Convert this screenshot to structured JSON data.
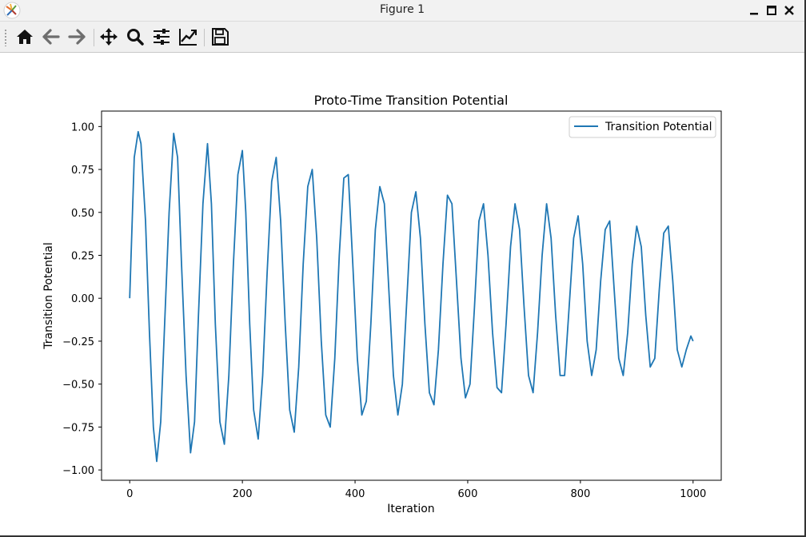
{
  "window": {
    "title": "Figure 1",
    "controls": [
      "minimize-icon",
      "maximize-icon",
      "close-icon"
    ]
  },
  "toolbar": {
    "buttons": [
      {
        "name": "home",
        "icon": "home-icon"
      },
      {
        "name": "back",
        "icon": "arrow-left-icon"
      },
      {
        "name": "forward",
        "icon": "arrow-right-icon"
      },
      {
        "name": "pan",
        "icon": "move-icon"
      },
      {
        "name": "zoom",
        "icon": "magnifier-icon"
      },
      {
        "name": "configure-subplots",
        "icon": "sliders-icon"
      },
      {
        "name": "edit-axis",
        "icon": "line-chart-icon"
      },
      {
        "name": "save",
        "icon": "floppy-disk-icon"
      }
    ]
  },
  "colors": {
    "line": "#1f77b4",
    "axes": "#000000",
    "background": "#ffffff"
  },
  "chart_data": {
    "type": "line",
    "title": "Proto-Time Transition Potential",
    "xlabel": "Iteration",
    "ylabel": "Transition Potential",
    "xlim": [
      -50,
      1050
    ],
    "ylim": [
      -1.06,
      1.09
    ],
    "xticks": [
      0,
      200,
      400,
      600,
      800,
      1000
    ],
    "xtick_labels": [
      "0",
      "200",
      "400",
      "600",
      "800",
      "1000"
    ],
    "yticks": [
      -1.0,
      -0.75,
      -0.5,
      -0.25,
      0.0,
      0.25,
      0.5,
      0.75,
      1.0
    ],
    "ytick_labels": [
      "−1.00",
      "−0.75",
      "−0.50",
      "−0.25",
      "0.00",
      "0.25",
      "0.50",
      "0.75",
      "1.00"
    ],
    "legend": {
      "position": "upper right",
      "entries": [
        "Transition Potential"
      ]
    },
    "grid": false,
    "series": [
      {
        "name": "Transition Potential",
        "color": "#1f77b4",
        "x": [
          0,
          8,
          15,
          20,
          28,
          35,
          42,
          48,
          55,
          62,
          70,
          78,
          85,
          92,
          100,
          108,
          115,
          122,
          130,
          138,
          145,
          152,
          160,
          168,
          176,
          184,
          192,
          200,
          206,
          213,
          220,
          228,
          236,
          244,
          252,
          260,
          268,
          276,
          284,
          292,
          300,
          308,
          316,
          324,
          332,
          340,
          348,
          356,
          364,
          372,
          380,
          388,
          396,
          404,
          412,
          420,
          428,
          436,
          444,
          452,
          460,
          468,
          476,
          484,
          492,
          500,
          508,
          516,
          524,
          532,
          540,
          548,
          556,
          564,
          572,
          580,
          588,
          596,
          604,
          612,
          620,
          628,
          636,
          644,
          652,
          660,
          668,
          676,
          684,
          692,
          700,
          708,
          716,
          724,
          732,
          740,
          748,
          756,
          764,
          772,
          780,
          788,
          796,
          804,
          812,
          820,
          828,
          836,
          844,
          852,
          860,
          868,
          876,
          884,
          892,
          900,
          908,
          916,
          924,
          932,
          940,
          948,
          956,
          964,
          972,
          980,
          988,
          996,
          1000
        ],
        "y": [
          0.0,
          0.82,
          0.97,
          0.9,
          0.45,
          -0.2,
          -0.75,
          -0.95,
          -0.72,
          -0.15,
          0.5,
          0.96,
          0.82,
          0.2,
          -0.45,
          -0.9,
          -0.72,
          -0.1,
          0.55,
          0.9,
          0.55,
          -0.15,
          -0.72,
          -0.85,
          -0.45,
          0.2,
          0.72,
          0.86,
          0.5,
          -0.15,
          -0.65,
          -0.82,
          -0.45,
          0.15,
          0.68,
          0.82,
          0.45,
          -0.15,
          -0.65,
          -0.78,
          -0.4,
          0.2,
          0.65,
          0.75,
          0.35,
          -0.25,
          -0.68,
          -0.75,
          -0.35,
          0.25,
          0.7,
          0.72,
          0.2,
          -0.35,
          -0.68,
          -0.6,
          -0.15,
          0.4,
          0.65,
          0.55,
          0.05,
          -0.45,
          -0.68,
          -0.5,
          0.0,
          0.5,
          0.62,
          0.35,
          -0.15,
          -0.55,
          -0.62,
          -0.3,
          0.2,
          0.6,
          0.55,
          0.1,
          -0.35,
          -0.58,
          -0.5,
          -0.05,
          0.45,
          0.55,
          0.25,
          -0.2,
          -0.52,
          -0.55,
          -0.15,
          0.3,
          0.55,
          0.4,
          -0.05,
          -0.45,
          -0.55,
          -0.2,
          0.25,
          0.55,
          0.35,
          -0.1,
          -0.45,
          -0.45,
          -0.05,
          0.35,
          0.48,
          0.2,
          -0.25,
          -0.45,
          -0.3,
          0.1,
          0.4,
          0.45,
          0.05,
          -0.35,
          -0.45,
          -0.2,
          0.2,
          0.42,
          0.3,
          -0.1,
          -0.4,
          -0.35,
          0.05,
          0.38,
          0.42,
          0.1,
          -0.3,
          -0.4,
          -0.3,
          -0.22,
          -0.25
        ]
      }
    ]
  }
}
